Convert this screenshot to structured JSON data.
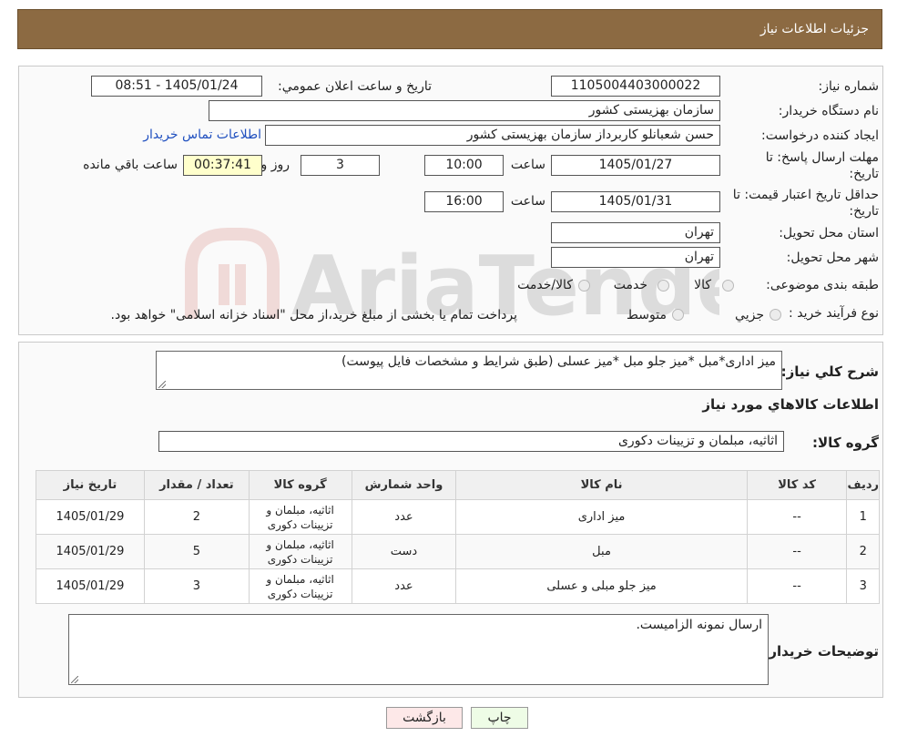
{
  "header": {
    "title": "جزئیات اطلاعات نیاز"
  },
  "form": {
    "need_number_label": "شماره نیاز:",
    "need_number": "1105004403000022",
    "announce_datetime_label": "تاریخ و ساعت اعلان عمومي:",
    "announce_datetime": "1405/01/24 - 08:51",
    "buyer_org_label": "نام دستگاه خريدار:",
    "buyer_org": "سازمان بهزیستی کشور",
    "creator_label": "ايجاد کننده درخواست:",
    "creator": "حسن  شعبانلو کاربرداز سازمان بهزیستی کشور",
    "contact_link": "اطلاعات تماس خريدار",
    "reply_deadline_label_line1": "مهلت ارسال پاسخ: تا",
    "reply_deadline_label_line2": "تاريخ:",
    "reply_date": "1405/01/27",
    "time_label": "ساعت",
    "reply_time": "10:00",
    "days_value": "3",
    "days_label": "روز و",
    "remaining_time": "00:37:41",
    "remaining_label": "ساعت باقي مانده",
    "min_validity_label_line1": "حداقل تاريخ اعتبار قيمت: تا",
    "min_validity_label_line2": "تاريخ:",
    "validity_date": "1405/01/31",
    "validity_time": "16:00",
    "province_label": "استان محل تحويل:",
    "province": "تهران",
    "city_label": "شهر محل تحويل:",
    "city": "تهران",
    "category_label": "طبقه بندی موضوعی:",
    "category_options": [
      "کالا",
      "خدمت",
      "کالا/خدمت"
    ],
    "process_label": "نوع فرآيند خريد :",
    "process_options": [
      "جزيي",
      "متوسط"
    ],
    "process_note": "پرداخت تمام يا بخشی از مبلغ خريد،از محل \"اسناد خزانه اسلامی\" خواهد بود."
  },
  "details": {
    "description_label": "شرح کلي نياز:",
    "description": "میز اداری*مبل *میز جلو مبل *میز عسلی (طبق شرایط و مشخصات فایل پیوست)",
    "goods_info_title": "اطلاعات کالاهاي مورد نياز",
    "goods_group_label": "گروه کالا:",
    "goods_group": "اثاثیه، مبلمان و تزیینات دکوری",
    "table": {
      "headers": [
        "رديف",
        "کد کالا",
        "نام کالا",
        "واحد شمارش",
        "گروه کالا",
        "تعداد / مقدار",
        "تاريخ نياز"
      ],
      "rows": [
        [
          "1",
          "--",
          "میز اداری",
          "عدد",
          "اثاثیه، مبلمان و تزیینات دکوری",
          "2",
          "1405/01/29"
        ],
        [
          "2",
          "--",
          "مبل",
          "دست",
          "اثاثیه، مبلمان و تزیینات دکوری",
          "5",
          "1405/01/29"
        ],
        [
          "3",
          "--",
          "میز جلو مبلی و عسلی",
          "عدد",
          "اثاثیه، مبلمان و تزیینات دکوری",
          "3",
          "1405/01/29"
        ]
      ]
    },
    "buyer_notes_label": "توضيحات خريدار:",
    "buyer_notes": "ارسال نمونه الزامیست."
  },
  "buttons": {
    "print": "چاپ",
    "return": "بازگشت"
  },
  "watermark": {
    "text": "AriaTender.neT"
  },
  "colors": {
    "header": "#8c6a42",
    "link": "#1f4fbf",
    "remaining_bg": "#ffffcc",
    "print_bg": "#eefce6",
    "return_bg": "#fde8e8"
  }
}
